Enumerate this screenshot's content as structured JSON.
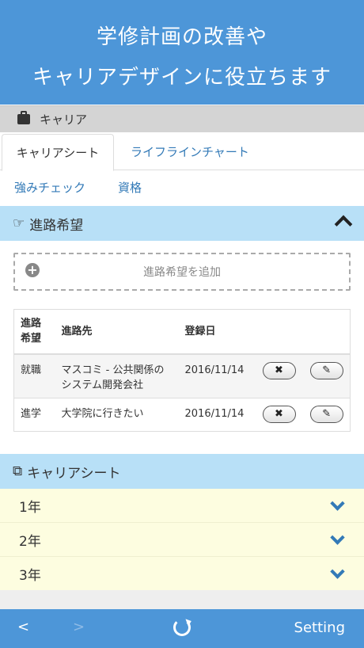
{
  "hero": {
    "line1": "学修計画の改善や",
    "line2": "キャリアデザインに役立ちます"
  },
  "section": {
    "label": "キャリア"
  },
  "tabs": [
    {
      "label": "キャリアシート",
      "active": true
    },
    {
      "label": "ライフラインチャート",
      "active": false
    }
  ],
  "subtabs": [
    {
      "label": "強みチェック"
    },
    {
      "label": "資格"
    }
  ],
  "career_goal": {
    "title": "進路希望",
    "add_label": "進路希望を追加",
    "table": {
      "headers": [
        "進路\n希望",
        "進路先",
        "登録日",
        ""
      ],
      "rows": [
        {
          "type": "就職",
          "destination": "マスコミ - 公共関係のシステム開発会社",
          "date": "2016/11/14"
        },
        {
          "type": "進学",
          "destination": "大学院に行きたい",
          "date": "2016/11/14"
        }
      ]
    }
  },
  "career_sheet": {
    "title": "キャリアシート",
    "years": [
      {
        "label": "1年"
      },
      {
        "label": "2年"
      },
      {
        "label": "3年"
      }
    ]
  },
  "toolbar": {
    "back": "<",
    "forward": ">",
    "setting": "Setting"
  },
  "colors": {
    "header_blue": "#4d96d8",
    "panel_blue": "#b8e0f7",
    "accordion_yellow": "#fdfde0",
    "link_blue": "#337ab7"
  }
}
